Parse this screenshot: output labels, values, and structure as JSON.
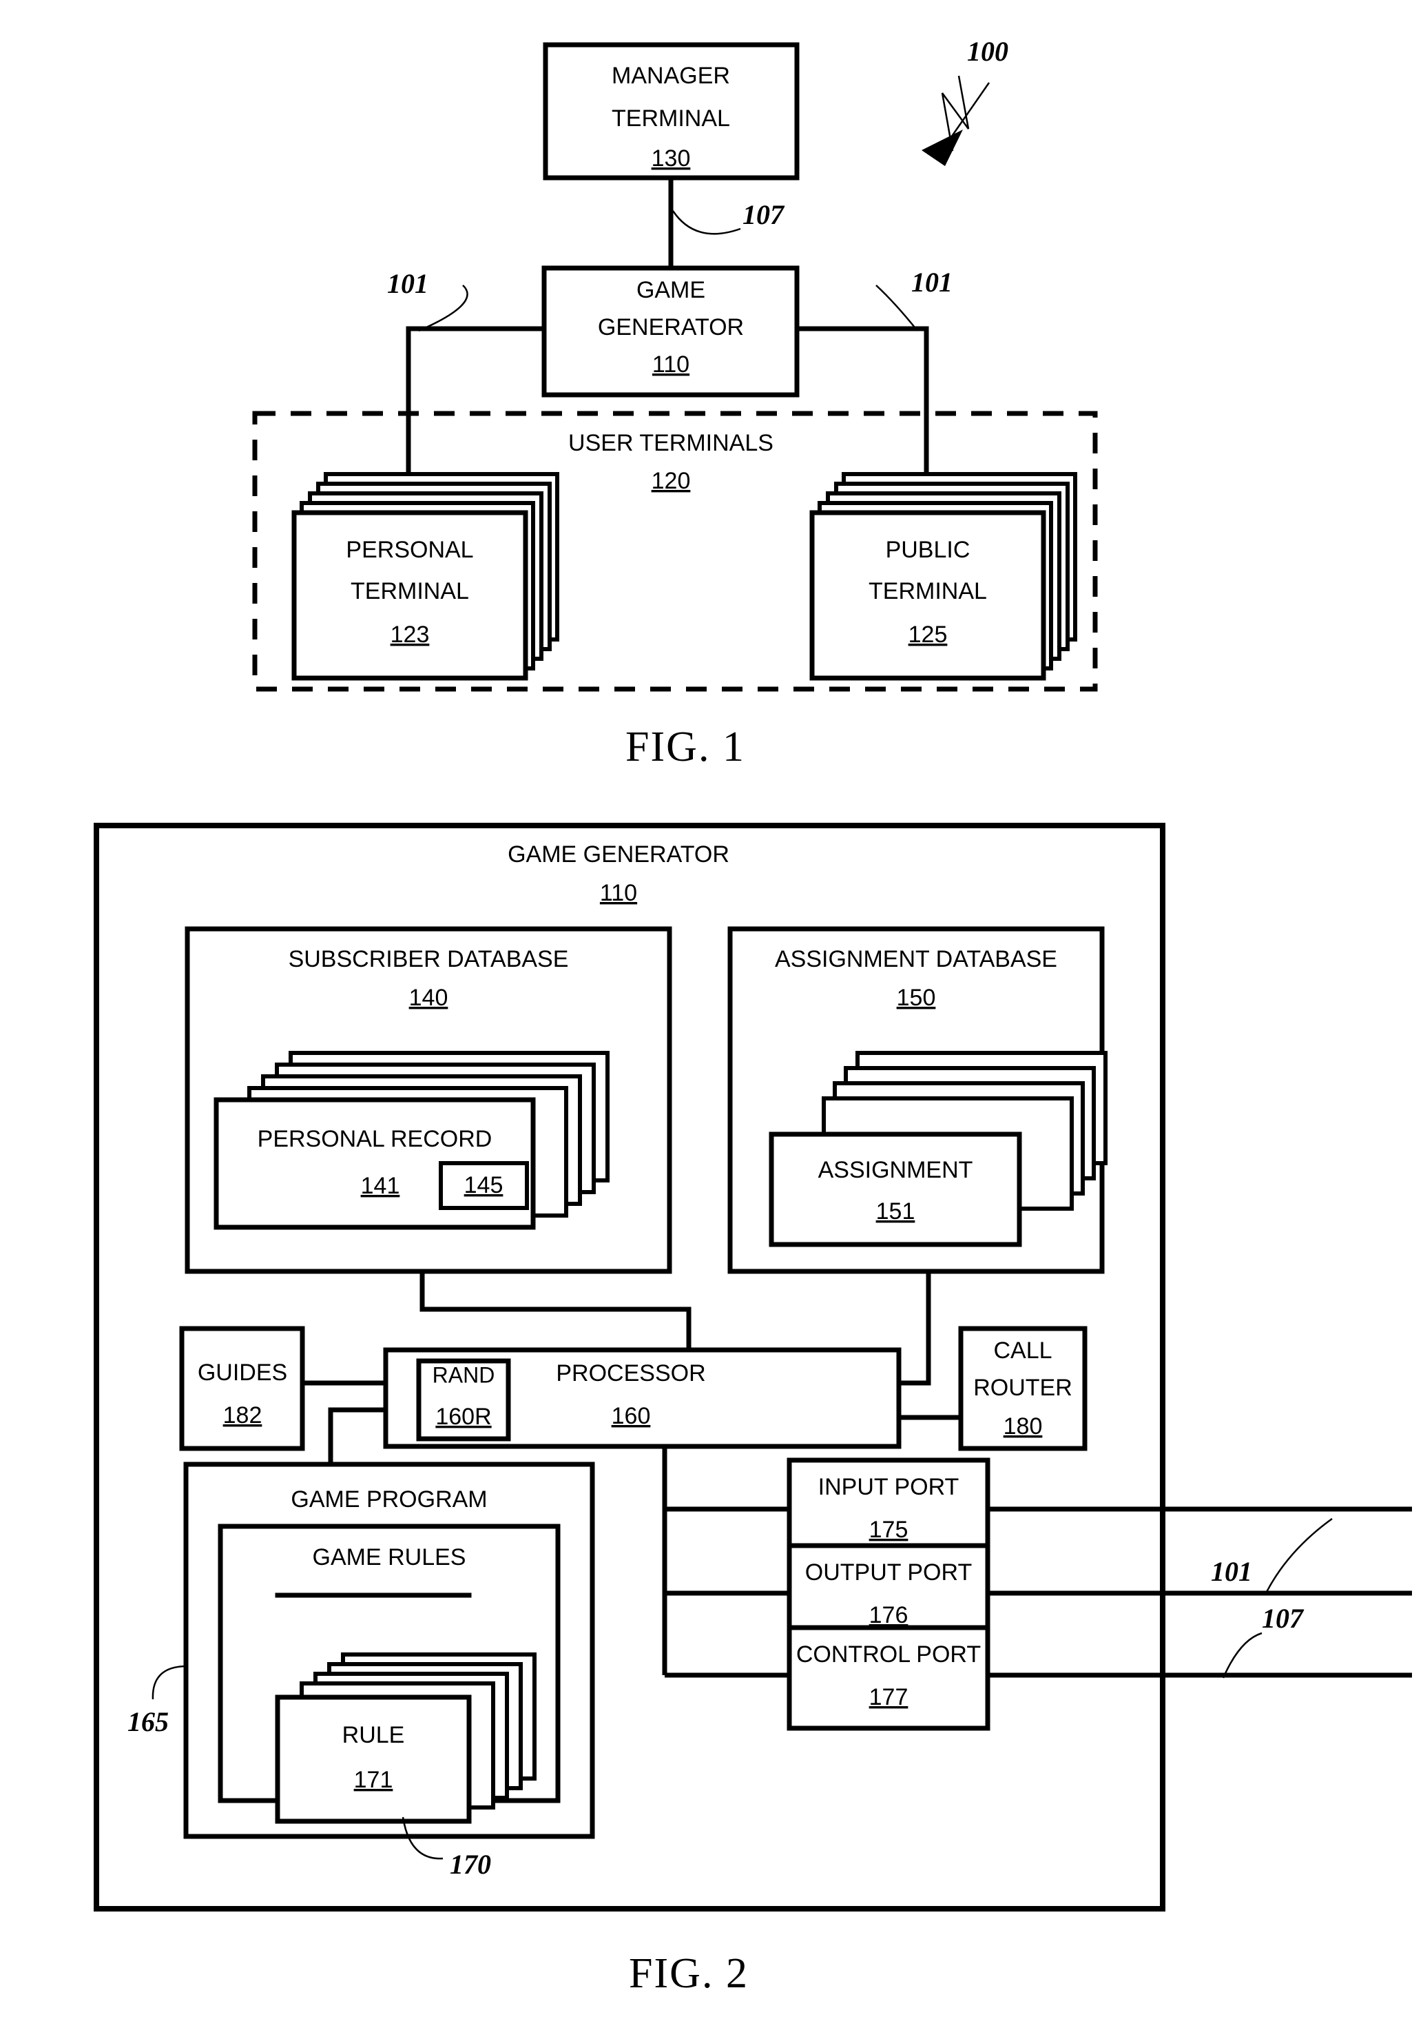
{
  "figures": [
    {
      "id": "fig1",
      "caption": "FIG. 1",
      "system_ref": "100",
      "nodes": {
        "manager_terminal": {
          "label_line1": "MANAGER",
          "label_line2": "TERMINAL",
          "ref": "130"
        },
        "game_generator": {
          "label_line1": "GAME",
          "label_line2": "GENERATOR",
          "ref": "110"
        },
        "user_terminals": {
          "label": "USER TERMINALS",
          "ref": "120"
        },
        "personal_terminal": {
          "label_line1": "PERSONAL",
          "label_line2": "TERMINAL",
          "ref": "123"
        },
        "public_terminal": {
          "label_line1": "PUBLIC",
          "label_line2": "TERMINAL",
          "ref": "125"
        }
      },
      "link_refs": {
        "control_link": "107",
        "left_user_link": "101",
        "right_user_link": "101"
      }
    },
    {
      "id": "fig2",
      "caption": "FIG. 2",
      "nodes": {
        "game_generator": {
          "label": "GAME GENERATOR",
          "ref": "110"
        },
        "subscriber_database": {
          "label": "SUBSCRIBER DATABASE",
          "ref": "140"
        },
        "personal_record": {
          "label": "PERSONAL RECORD",
          "ref": "141",
          "inner_ref": "145"
        },
        "assignment_database": {
          "label": "ASSIGNMENT DATABASE",
          "ref": "150"
        },
        "assignment": {
          "label": "ASSIGNMENT",
          "ref": "151"
        },
        "guides": {
          "label": "GUIDES",
          "ref": "182"
        },
        "rand": {
          "label": "RAND",
          "ref": "160R"
        },
        "processor": {
          "label": "PROCESSOR",
          "ref": "160"
        },
        "call_router": {
          "label_line1": "CALL",
          "label_line2": "ROUTER",
          "ref": "180"
        },
        "game_program": {
          "label": "GAME PROGRAM",
          "ref": "165"
        },
        "game_rules": {
          "label": "GAME RULES",
          "ref": "170"
        },
        "rule": {
          "label": "RULE",
          "ref": "171"
        },
        "input_port": {
          "label": "INPUT PORT",
          "ref": "175"
        },
        "output_port": {
          "label": "OUTPUT PORT",
          "ref": "176"
        },
        "control_port": {
          "label": "CONTROL PORT",
          "ref": "177"
        }
      },
      "link_refs": {
        "user_link": "101",
        "control_link": "107"
      }
    }
  ]
}
